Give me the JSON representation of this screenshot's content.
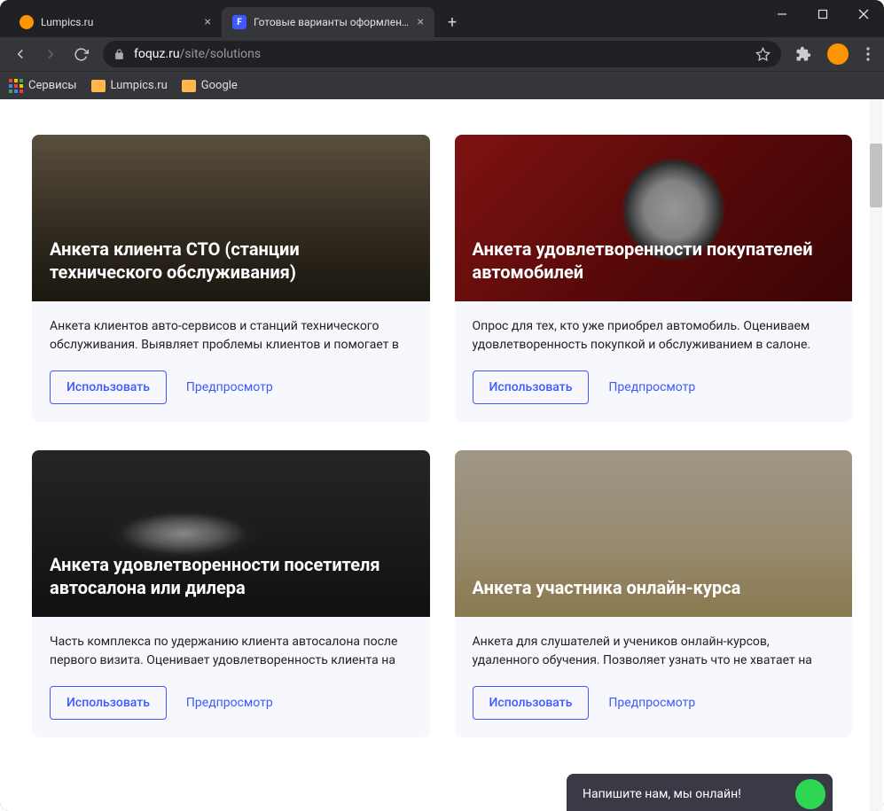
{
  "tabs": [
    {
      "title": "Lumpics.ru",
      "favicon": "orange"
    },
    {
      "title": "Готовые варианты оформления",
      "favicon": "blue",
      "favicon_letter": "F"
    }
  ],
  "url": {
    "domain": "foquz.ru",
    "path": "/site/solutions"
  },
  "bookmarks": [
    {
      "label": "Сервисы",
      "type": "grid"
    },
    {
      "label": "Lumpics.ru",
      "type": "folder"
    },
    {
      "label": "Google",
      "type": "folder"
    }
  ],
  "cards": [
    {
      "title": "Анкета клиента СТО (станции технического обслуживания)",
      "desc": "Анкета клиентов авто-сервисов и станций технического обслуживания. Выявляет проблемы клиентов и помогает в",
      "use_label": "Использовать",
      "preview_label": "Предпросмотр"
    },
    {
      "title": "Анкета удовлетворенности покупателей автомобилей",
      "desc": "Опрос для тех, кто уже приобрел автомобиль. Оцениваем удовлетворенность покупкой и обслуживанием в салоне.",
      "use_label": "Использовать",
      "preview_label": "Предпросмотр"
    },
    {
      "title": "Анкета удовлетворенности посетителя автосалона или дилера",
      "desc": "Часть комплекса по удержанию клиента автосалона после первого визита. Оценивает удовлетворенность клиента на",
      "use_label": "Использовать",
      "preview_label": "Предпросмотр"
    },
    {
      "title": "Анкета участника онлайн‑курса",
      "desc": "Анкета для слушателей и учеников онлайн‑курсов, удаленного обучения. Позволяет узнать что не хватает на",
      "use_label": "Использовать",
      "preview_label": "Предпросмотр"
    }
  ],
  "chat": {
    "text": "Напишите нам, мы онлайн!"
  }
}
